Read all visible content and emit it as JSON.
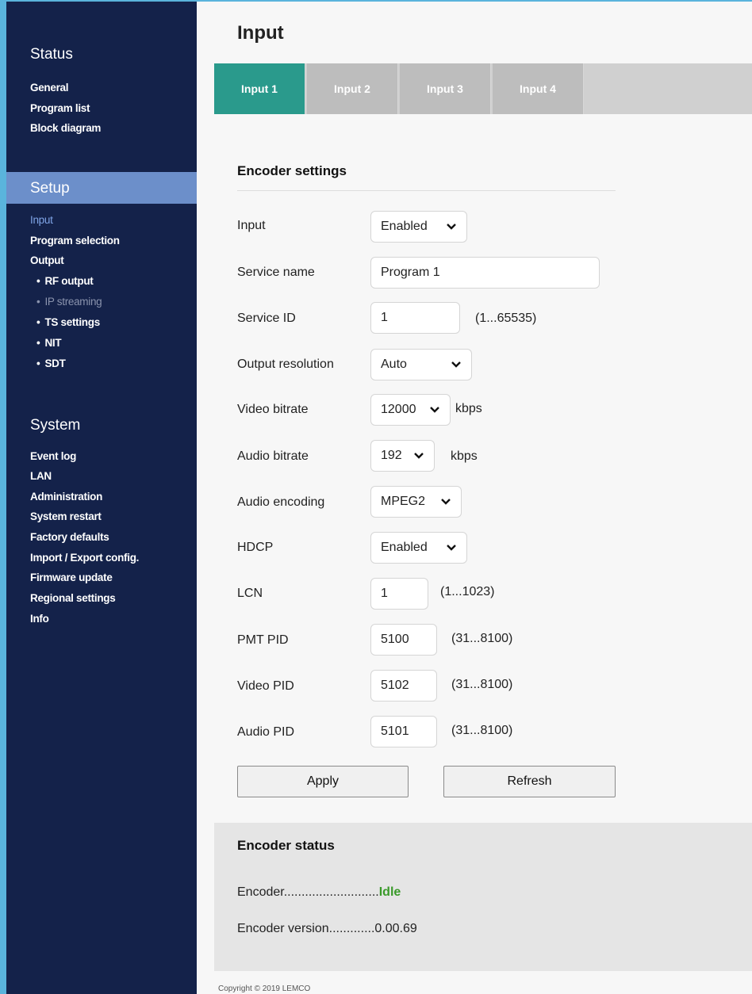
{
  "sidebar": {
    "status": {
      "title": "Status",
      "items": [
        "General",
        "Program list",
        "Block diagram"
      ]
    },
    "setup": {
      "title": "Setup",
      "items": {
        "input": "Input",
        "program_selection": "Program selection",
        "output": "Output",
        "rf_output": "RF output",
        "ip_streaming": "IP streaming",
        "ts_settings": "TS settings",
        "nit": "NIT",
        "sdt": "SDT"
      }
    },
    "system": {
      "title": "System",
      "items": [
        "Event log",
        "LAN",
        "Administration",
        "System restart",
        "Factory defaults",
        "Import / Export config.",
        "Firmware update",
        "Regional settings",
        "Info"
      ]
    }
  },
  "page": {
    "title": "Input",
    "tabs": [
      "Input 1",
      "Input 2",
      "Input 3",
      "Input 4"
    ],
    "active_tab": "Input 1"
  },
  "encoder_settings": {
    "title": "Encoder settings",
    "input": {
      "label": "Input",
      "value": "Enabled"
    },
    "service_name": {
      "label": "Service name",
      "value": "Program 1"
    },
    "service_id": {
      "label": "Service ID",
      "value": "1",
      "range": "(1...65535)"
    },
    "output_resolution": {
      "label": "Output resolution",
      "value": "Auto"
    },
    "video_bitrate": {
      "label": "Video bitrate",
      "value": "12000",
      "unit": "kbps"
    },
    "audio_bitrate": {
      "label": "Audio bitrate",
      "value": "192",
      "unit": "kbps"
    },
    "audio_encoding": {
      "label": "Audio encoding",
      "value": "MPEG2"
    },
    "hdcp": {
      "label": "HDCP",
      "value": "Enabled"
    },
    "lcn": {
      "label": "LCN",
      "value": "1",
      "range": "(1...1023)"
    },
    "pmt_pid": {
      "label": "PMT PID",
      "value": "5100",
      "range": "(31...8100)"
    },
    "video_pid": {
      "label": "Video PID",
      "value": "5102",
      "range": "(31...8100)"
    },
    "audio_pid": {
      "label": "Audio PID",
      "value": "5101",
      "range": "(31...8100)"
    },
    "apply_label": "Apply",
    "refresh_label": "Refresh"
  },
  "encoder_status": {
    "title": "Encoder status",
    "encoder_label": "Encoder...........................",
    "encoder_value": "Idle",
    "version_label": "Encoder version.............",
    "version_value": "0.00.69"
  },
  "footer": {
    "copyright": "Copyright © 2019 LEMCO"
  },
  "colors": {
    "sidebar_bg": "#14224a",
    "setup_band": "#6c8fca",
    "active_tab": "#2a9a8c",
    "inactive_tab": "#bdbdbd",
    "status_ok": "#3a9a2a",
    "active_nav": "#7fa4e6"
  }
}
